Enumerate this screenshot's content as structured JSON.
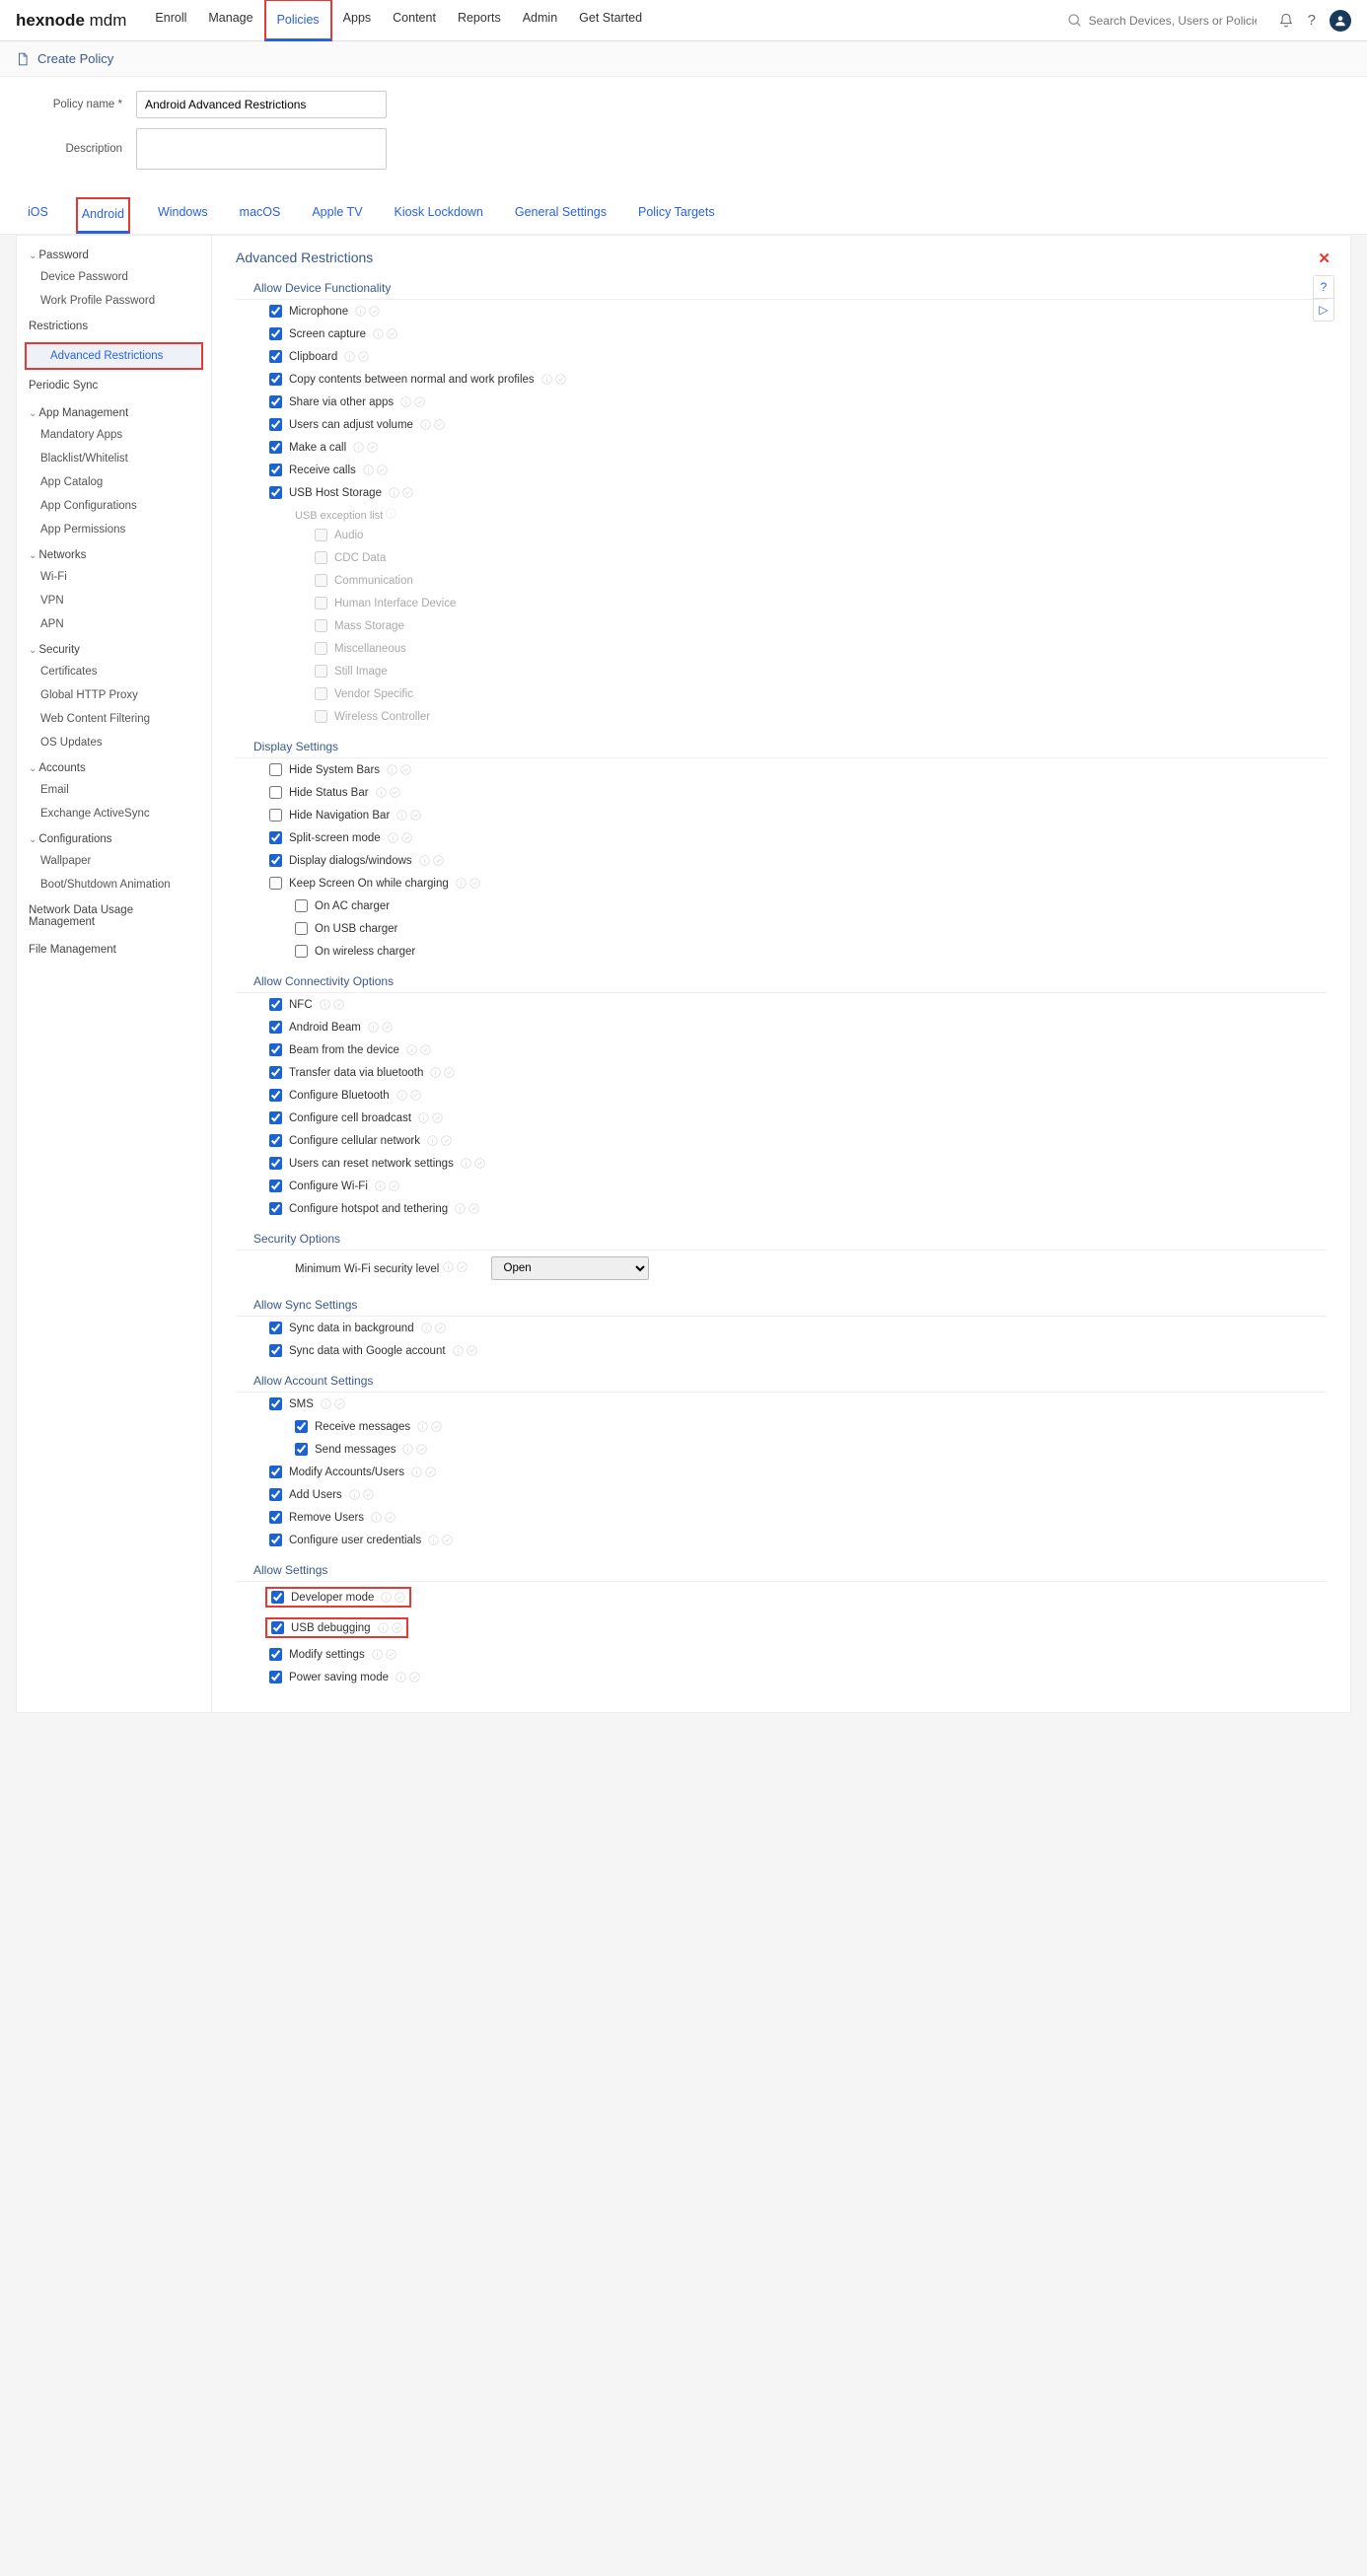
{
  "logo": {
    "a": "hexnode",
    "b": "mdm"
  },
  "topnav": [
    "Enroll",
    "Manage",
    "Policies",
    "Apps",
    "Content",
    "Reports",
    "Admin",
    "Get Started"
  ],
  "topnav_active": "Policies",
  "search_placeholder": "Search Devices, Users or Policies",
  "page_title": "Create Policy",
  "form": {
    "name_label": "Policy name *",
    "name_value": "Android Advanced Restrictions",
    "desc_label": "Description"
  },
  "subtabs": [
    "iOS",
    "Android",
    "Windows",
    "macOS",
    "Apple TV",
    "Kiosk Lockdown",
    "General Settings",
    "Policy Targets"
  ],
  "subtab_active": "Android",
  "sidebar": [
    {
      "type": "group",
      "label": "Password",
      "items": [
        "Device Password",
        "Work Profile Password"
      ]
    },
    {
      "type": "plain",
      "label": "Restrictions"
    },
    {
      "type": "plain",
      "label": "Advanced Restrictions",
      "selected": true,
      "highlight": true
    },
    {
      "type": "plain",
      "label": "Periodic Sync"
    },
    {
      "type": "group",
      "label": "App Management",
      "items": [
        "Mandatory Apps",
        "Blacklist/Whitelist",
        "App Catalog",
        "App Configurations",
        "App Permissions"
      ]
    },
    {
      "type": "group",
      "label": "Networks",
      "items": [
        "Wi-Fi",
        "VPN",
        "APN"
      ]
    },
    {
      "type": "group",
      "label": "Security",
      "items": [
        "Certificates",
        "Global HTTP Proxy",
        "Web Content Filtering",
        "OS Updates"
      ]
    },
    {
      "type": "group",
      "label": "Accounts",
      "items": [
        "Email",
        "Exchange ActiveSync"
      ]
    },
    {
      "type": "group",
      "label": "Configurations",
      "items": [
        "Wallpaper",
        "Boot/Shutdown Animation"
      ]
    },
    {
      "type": "plain",
      "label": "Network Data Usage Management"
    },
    {
      "type": "plain",
      "label": "File Management"
    }
  ],
  "content_title": "Advanced Restrictions",
  "sections": [
    {
      "title": "Allow Device Functionality",
      "items": [
        {
          "label": "Microphone",
          "checked": true
        },
        {
          "label": "Screen capture",
          "checked": true
        },
        {
          "label": "Clipboard",
          "checked": true
        },
        {
          "label": "Copy contents between normal and work profiles",
          "checked": true
        },
        {
          "label": "Share via other apps",
          "checked": true
        },
        {
          "label": "Users can adjust volume",
          "checked": true
        },
        {
          "label": "Make a call",
          "checked": true
        },
        {
          "label": "Receive calls",
          "checked": true
        },
        {
          "label": "USB Host Storage",
          "checked": true,
          "sublabel": "USB exception list",
          "subs": [
            {
              "label": "Audio"
            },
            {
              "label": "CDC Data"
            },
            {
              "label": "Communication"
            },
            {
              "label": "Human Interface Device"
            },
            {
              "label": "Mass Storage"
            },
            {
              "label": "Miscellaneous"
            },
            {
              "label": "Still Image"
            },
            {
              "label": "Vendor Specific"
            },
            {
              "label": "Wireless Controller"
            }
          ]
        }
      ]
    },
    {
      "title": "Display Settings",
      "items": [
        {
          "label": "Hide System Bars",
          "checked": false
        },
        {
          "label": "Hide Status Bar",
          "checked": false
        },
        {
          "label": "Hide Navigation Bar",
          "checked": false
        },
        {
          "label": "Split-screen mode",
          "checked": true
        },
        {
          "label": "Display dialogs/windows",
          "checked": true
        },
        {
          "label": "Keep Screen On while charging",
          "checked": false,
          "subs2": [
            {
              "label": "On AC charger"
            },
            {
              "label": "On USB charger"
            },
            {
              "label": "On wireless charger"
            }
          ]
        }
      ]
    },
    {
      "title": "Allow Connectivity Options",
      "items": [
        {
          "label": "NFC",
          "checked": true
        },
        {
          "label": "Android Beam",
          "checked": true
        },
        {
          "label": "Beam from the device",
          "checked": true
        },
        {
          "label": "Transfer data via bluetooth",
          "checked": true
        },
        {
          "label": "Configure Bluetooth",
          "checked": true
        },
        {
          "label": "Configure cell broadcast",
          "checked": true
        },
        {
          "label": "Configure cellular network",
          "checked": true
        },
        {
          "label": "Users can reset network settings",
          "checked": true
        },
        {
          "label": "Configure Wi-Fi",
          "checked": true
        },
        {
          "label": "Configure hotspot and tethering",
          "checked": true
        }
      ]
    },
    {
      "title": "Security Options",
      "select": {
        "label": "Minimum Wi-Fi security level",
        "value": "Open"
      }
    },
    {
      "title": "Allow Sync Settings",
      "items": [
        {
          "label": "Sync data in background",
          "checked": true
        },
        {
          "label": "Sync data with Google account",
          "checked": true
        }
      ]
    },
    {
      "title": "Allow Account Settings",
      "items": [
        {
          "label": "SMS",
          "checked": true,
          "subs3": [
            {
              "label": "Receive messages",
              "checked": true
            },
            {
              "label": "Send messages",
              "checked": true
            }
          ]
        },
        {
          "label": "Modify Accounts/Users",
          "checked": true
        },
        {
          "label": "Add Users",
          "checked": true
        },
        {
          "label": "Remove Users",
          "checked": true
        },
        {
          "label": "Configure user credentials",
          "checked": true
        }
      ]
    },
    {
      "title": "Allow Settings",
      "items": [
        {
          "label": "Developer mode",
          "checked": true,
          "highlight": true
        },
        {
          "label": "USB debugging",
          "checked": true,
          "highlight": true
        },
        {
          "label": "Modify settings",
          "checked": true
        },
        {
          "label": "Power saving mode",
          "checked": true
        }
      ]
    }
  ]
}
